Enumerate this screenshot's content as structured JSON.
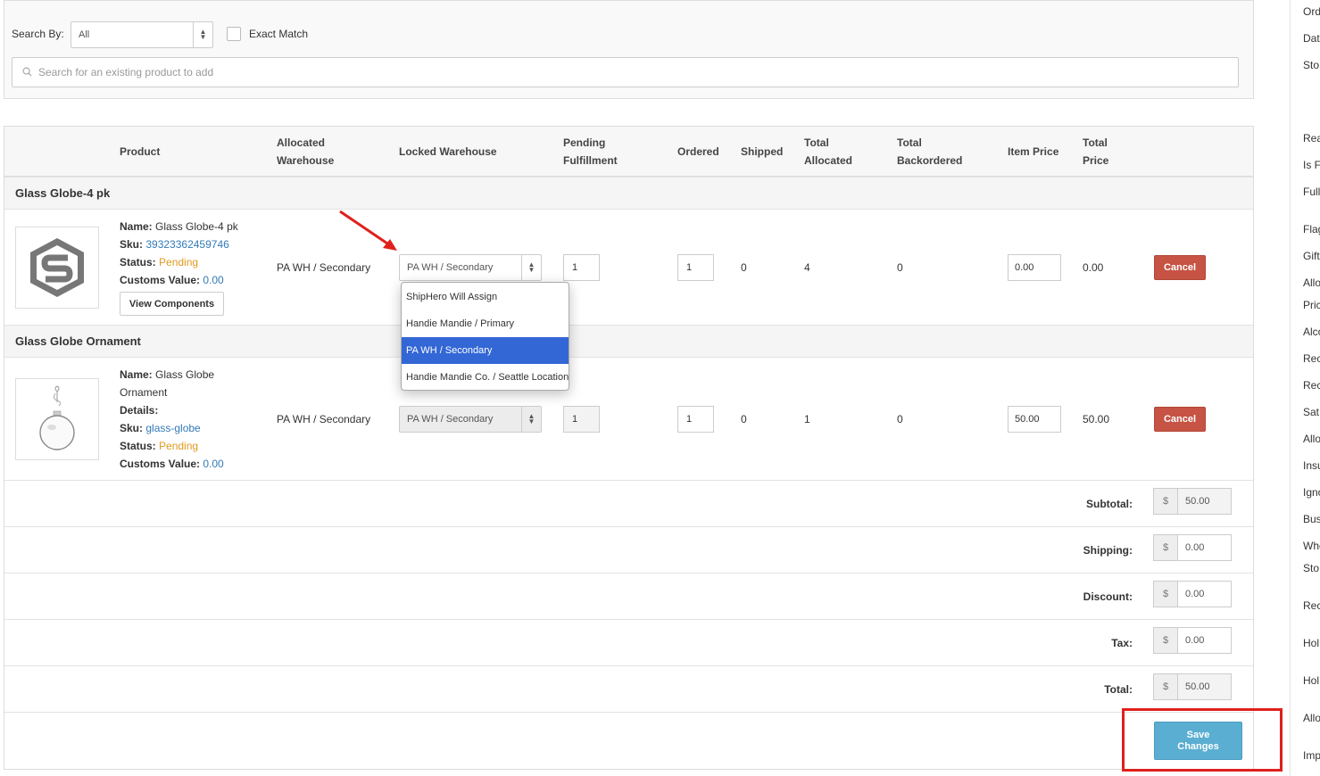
{
  "search": {
    "search_by_label": "Search By:",
    "search_by_value": "All",
    "exact_match_label": "Exact Match",
    "placeholder": "Search for an existing product to add"
  },
  "table": {
    "headers": {
      "product": "Product",
      "allocated_warehouse_1": "Allocated",
      "allocated_warehouse_2": "Warehouse",
      "locked_warehouse": "Locked Warehouse",
      "pending_1": "Pending",
      "pending_2": "Fulfillment",
      "ordered": "Ordered",
      "shipped": "Shipped",
      "total_allocated_1": "Total",
      "total_allocated_2": "Allocated",
      "total_backordered_1": "Total",
      "total_backordered_2": "Backordered",
      "item_price": "Item Price",
      "total_price_1": "Total",
      "total_price_2": "Price"
    },
    "items": [
      {
        "group_title": "Glass Globe-4 pk",
        "name_label": "Name:",
        "name": "Glass Globe-4 pk",
        "sku_label": "Sku:",
        "sku": "39323362459746",
        "status_label": "Status:",
        "status": "Pending",
        "customs_label": "Customs Value:",
        "customs_value": "0.00",
        "view_components": "View Components",
        "allocated_warehouse": "PA WH / Secondary",
        "locked_warehouse": "PA WH / Secondary",
        "pending": "1",
        "ordered": "1",
        "shipped": "0",
        "total_allocated": "4",
        "total_backordered": "0",
        "item_price": "0.00",
        "total_price": "0.00",
        "cancel": "Cancel"
      },
      {
        "group_title": "Glass Globe Ornament",
        "name_label": "Name:",
        "name_1": "Glass Globe",
        "name_2": "Ornament",
        "details_label": "Details:",
        "sku_label": "Sku:",
        "sku": "glass-globe",
        "status_label": "Status:",
        "status": "Pending",
        "customs_label": "Customs Value:",
        "customs_value": "0.00",
        "allocated_warehouse": "PA WH / Secondary",
        "locked_warehouse": "PA WH / Secondary",
        "pending": "1",
        "ordered": "1",
        "shipped": "0",
        "total_allocated": "1",
        "total_backordered": "0",
        "item_price": "50.00",
        "total_price": "50.00",
        "cancel": "Cancel"
      }
    ]
  },
  "dropdown": {
    "options": [
      "ShipHero Will Assign",
      "Handie Mandie / Primary",
      "PA WH / Secondary",
      "Handie Mandie Co. / Seattle Location"
    ],
    "selected_index": 2
  },
  "totals": {
    "currency": "$",
    "subtotal_label": "Subtotal:",
    "subtotal": "50.00",
    "shipping_label": "Shipping:",
    "shipping": "0.00",
    "discount_label": "Discount:",
    "discount": "0.00",
    "tax_label": "Tax:",
    "tax": "0.00",
    "total_label": "Total:",
    "total": "50.00"
  },
  "save_button_line1": "Save",
  "save_button_line2": "Changes",
  "sidebar_labels": [
    "Ord",
    "Dat",
    "Sto",
    "Rea",
    "Is F",
    "Full",
    "Flag",
    "Gift",
    "Allo",
    "Pric",
    "Alco",
    "Rec",
    "Rec",
    "Sat",
    "Allo",
    "Insu",
    "Igno",
    "Bus",
    "Whe",
    "Sto",
    "Rec",
    "Hol",
    "Hol",
    "Allo",
    "Imp"
  ],
  "colors": {
    "selected_option": "#3367d6",
    "cancel": "#c65344",
    "save": "#5aaed1",
    "pending": "#e09a1e",
    "link": "#337ab7",
    "annotation": "#e0201c"
  }
}
